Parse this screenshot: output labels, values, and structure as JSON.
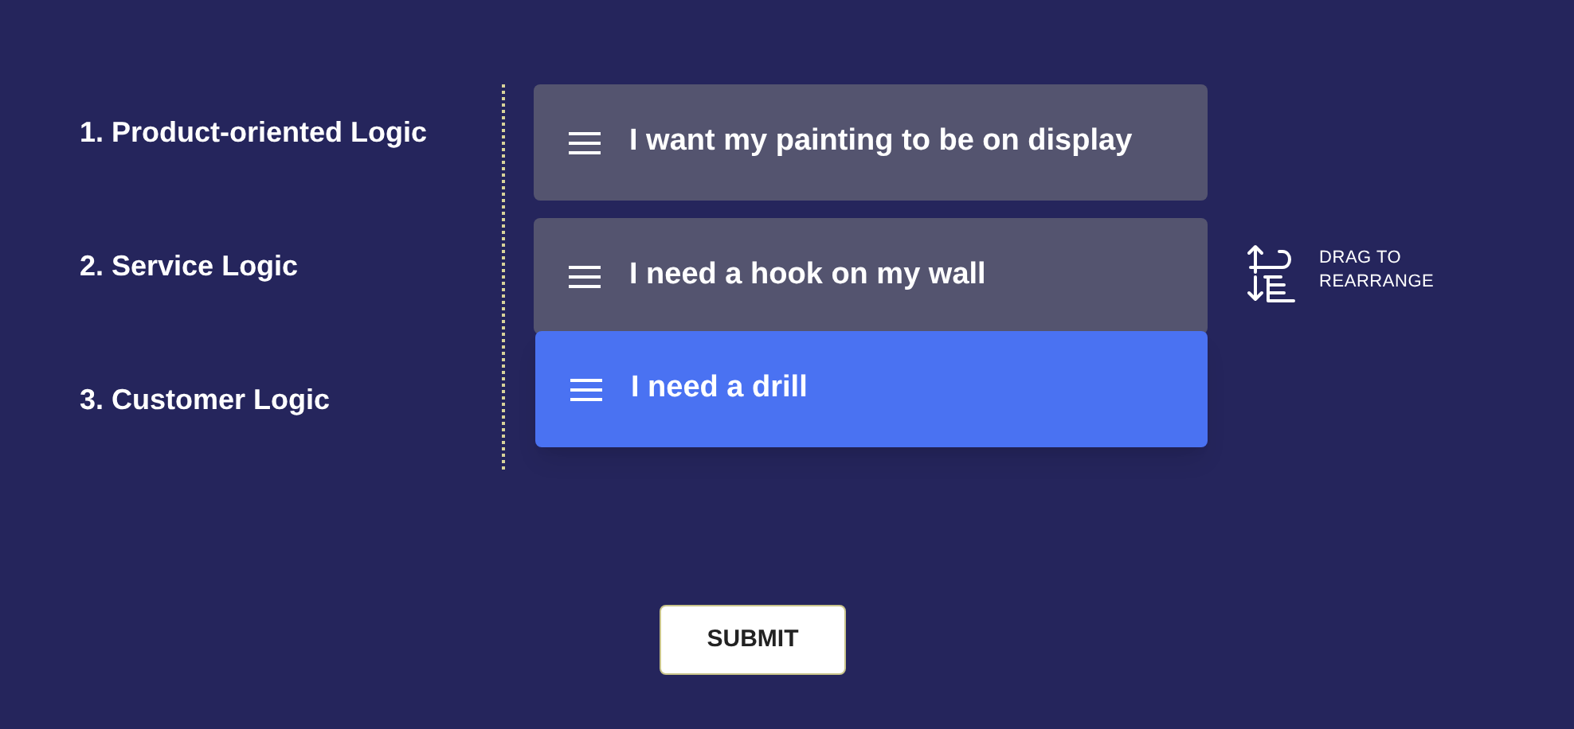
{
  "logics": [
    "1. Product-oriented Logic",
    "2. Service Logic",
    "3. Customer Logic"
  ],
  "items": [
    {
      "label": "I want my painting to be on display",
      "dragging": false
    },
    {
      "label": "I need a hook on my wall",
      "dragging": false
    },
    {
      "label": "I need a drill",
      "dragging": true
    }
  ],
  "hint": [
    "DRAG TO",
    "REARRANGE"
  ],
  "submit": "SUBMIT"
}
